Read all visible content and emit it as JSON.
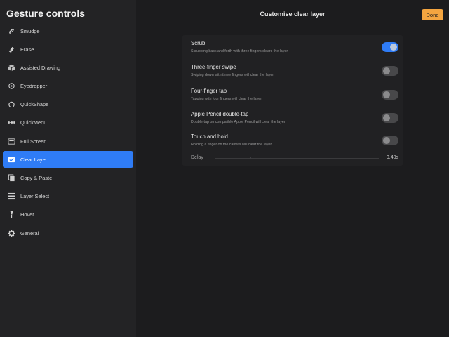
{
  "sidebar": {
    "title": "Gesture controls",
    "items": [
      {
        "label": "Smudge",
        "icon": "smudge-icon",
        "active": false
      },
      {
        "label": "Erase",
        "icon": "eraser-icon",
        "active": false
      },
      {
        "label": "Assisted Drawing",
        "icon": "cube-icon",
        "active": false
      },
      {
        "label": "Eyedropper",
        "icon": "eyedropper-icon",
        "active": false
      },
      {
        "label": "QuickShape",
        "icon": "quickshape-icon",
        "active": false
      },
      {
        "label": "QuickMenu",
        "icon": "quickmenu-icon",
        "active": false
      },
      {
        "label": "Full Screen",
        "icon": "fullscreen-icon",
        "active": false
      },
      {
        "label": "Clear Layer",
        "icon": "clear-layer-icon",
        "active": true
      },
      {
        "label": "Copy & Paste",
        "icon": "copy-paste-icon",
        "active": false
      },
      {
        "label": "Layer Select",
        "icon": "layer-select-icon",
        "active": false
      },
      {
        "label": "Hover",
        "icon": "hover-icon",
        "active": false
      },
      {
        "label": "General",
        "icon": "gear-icon",
        "active": false
      }
    ]
  },
  "header": {
    "title": "Customise clear layer",
    "done_label": "Done"
  },
  "options": [
    {
      "title": "Scrub",
      "description": "Scrubbing back and forth with three fingers clears the layer",
      "enabled": true
    },
    {
      "title": "Three-finger swipe",
      "description": "Swiping down with three fingers will clear the layer",
      "enabled": false
    },
    {
      "title": "Four-finger tap",
      "description": "Tapping with four fingers will clear the layer",
      "enabled": false
    },
    {
      "title": "Apple Pencil double-tap",
      "description": "Double-tap on compatible Apple Pencil will clear the layer",
      "enabled": false
    },
    {
      "title": "Touch and hold",
      "description": "Holding a finger on the canvas will clear the layer",
      "enabled": false
    }
  ],
  "delay": {
    "label": "Delay",
    "value": "0.40s"
  },
  "colors": {
    "accent": "#2f7cf6",
    "done_button": "#f4a540",
    "background": "#1c1c1e",
    "sidebar": "#232325"
  }
}
